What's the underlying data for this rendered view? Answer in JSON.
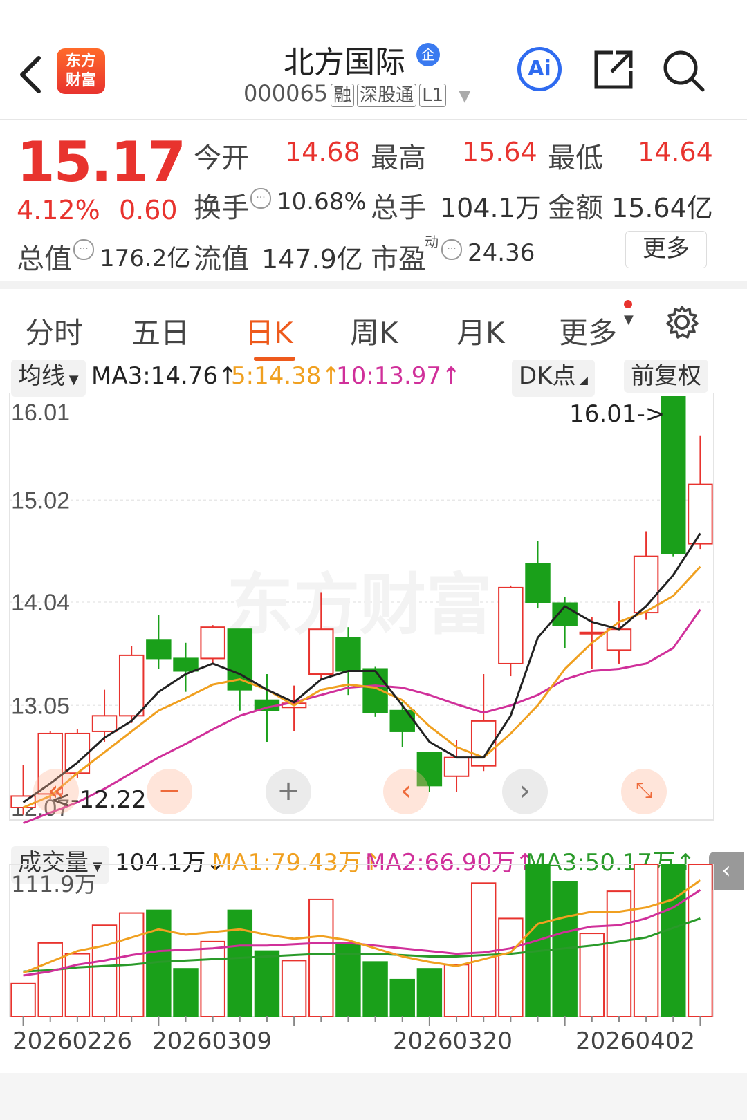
{
  "header": {
    "back_icon": "chevron-left-icon",
    "logo_text_1": "东方",
    "logo_text_2": "财富",
    "stock_name": "北方国际",
    "enterprise_badge": "企",
    "stock_code": "000065",
    "tags": [
      "融",
      "深股通",
      "L1"
    ],
    "ai_label": "Ai",
    "share_icon": "share-icon",
    "search_icon": "search-icon"
  },
  "quote": {
    "price": "15.17",
    "change_pct": "4.12%",
    "change_amt": "0.60",
    "open_label": "今开",
    "open": "14.68",
    "high_label": "最高",
    "high": "15.64",
    "low_label": "最低",
    "low": "14.64",
    "turnover_label": "换手",
    "turnover": "10.68%",
    "volume_label": "总手",
    "volume": "104.1万",
    "amount_label": "金额",
    "amount": "15.64亿",
    "mktcap_label": "总值",
    "mktcap": "176.2亿",
    "float_label": "流值",
    "float_cap": "147.9亿",
    "pe_label": "市盈",
    "pe_sup": "动",
    "pe": "24.36",
    "more_button": "更多"
  },
  "tabs": [
    "分时",
    "五日",
    "日K",
    "周K",
    "月K",
    "更多"
  ],
  "active_tab": "日K",
  "ma_row": {
    "selector": "均线",
    "ma3": "MA3:14.76",
    "ma5": "5:14.38",
    "ma10": "10:13.97",
    "dk_button": "DK点",
    "adjust_button": "前复权"
  },
  "colors": {
    "up": "#e8332e",
    "down": "#1aa01a",
    "ma3": "#222222",
    "ma5": "#f0a020",
    "ma10": "#d0309a",
    "vol_ma3": "#2a9a2a",
    "accent": "#ee5a1c"
  },
  "chart_labels": {
    "y_ticks": [
      "16.01",
      "15.02",
      "14.04",
      "13.05",
      "12.07"
    ],
    "max_label": "16.01->",
    "min_label": "<-12.22"
  },
  "volume_row": {
    "selector": "成交量",
    "vol": "104.1万",
    "ma1": "MA1:79.43万",
    "ma2": "MA2:66.90万",
    "ma3": "MA3:50.17万",
    "vol_max": "111.9万"
  },
  "x_dates": [
    "20260226",
    "20260309",
    "20260320",
    "20260402"
  ],
  "chart_data": {
    "type": "candlestick",
    "ylim": [
      12.07,
      16.01
    ],
    "candles": [
      {
        "o": 12.07,
        "c": 12.18,
        "h": 12.48,
        "l": 12.0
      },
      {
        "o": 12.2,
        "c": 12.78,
        "h": 12.8,
        "l": 12.15
      },
      {
        "o": 12.4,
        "c": 12.78,
        "h": 12.82,
        "l": 12.35
      },
      {
        "o": 12.8,
        "c": 12.95,
        "h": 13.2,
        "l": 12.7
      },
      {
        "o": 12.95,
        "c": 13.53,
        "h": 13.62,
        "l": 12.88
      },
      {
        "o": 13.68,
        "c": 13.5,
        "h": 13.92,
        "l": 13.4
      },
      {
        "o": 13.5,
        "c": 13.38,
        "h": 13.65,
        "l": 13.18
      },
      {
        "o": 13.5,
        "c": 13.8,
        "h": 13.82,
        "l": 13.44
      },
      {
        "o": 13.78,
        "c": 13.2,
        "h": 13.78,
        "l": 13.0
      },
      {
        "o": 13.1,
        "c": 13.0,
        "h": 13.35,
        "l": 12.7
      },
      {
        "o": 13.03,
        "c": 13.07,
        "h": 13.24,
        "l": 12.8
      },
      {
        "o": 13.35,
        "c": 13.78,
        "h": 14.13,
        "l": 13.3
      },
      {
        "o": 13.7,
        "c": 13.38,
        "h": 13.8,
        "l": 13.15
      },
      {
        "o": 13.4,
        "c": 12.98,
        "h": 13.42,
        "l": 12.94
      },
      {
        "o": 13.0,
        "c": 12.8,
        "h": 13.08,
        "l": 12.65
      },
      {
        "o": 12.6,
        "c": 12.28,
        "h": 12.6,
        "l": 12.22
      },
      {
        "o": 12.37,
        "c": 12.55,
        "h": 12.72,
        "l": 12.22
      },
      {
        "o": 12.47,
        "c": 12.9,
        "h": 13.35,
        "l": 12.42
      },
      {
        "o": 13.45,
        "c": 14.18,
        "h": 14.2,
        "l": 13.33
      },
      {
        "o": 14.41,
        "c": 14.04,
        "h": 14.63,
        "l": 13.98
      },
      {
        "o": 14.03,
        "c": 13.82,
        "h": 14.09,
        "l": 13.6
      },
      {
        "o": 13.75,
        "c": 13.75,
        "h": 13.9,
        "l": 13.4
      },
      {
        "o": 13.58,
        "c": 13.78,
        "h": 14.05,
        "l": 13.45
      },
      {
        "o": 13.94,
        "c": 14.48,
        "h": 14.72,
        "l": 13.87
      },
      {
        "o": 16.01,
        "c": 14.51,
        "h": 16.01,
        "l": 14.48
      },
      {
        "o": 14.6,
        "c": 15.17,
        "h": 15.64,
        "l": 14.55
      }
    ],
    "ma3": [
      12.12,
      12.3,
      12.5,
      12.74,
      12.9,
      13.18,
      13.35,
      13.45,
      13.35,
      13.2,
      13.08,
      13.3,
      13.38,
      13.38,
      13.05,
      12.7,
      12.55,
      12.55,
      12.95,
      13.7,
      14.0,
      13.85,
      13.78,
      14.0,
      14.3,
      14.7
    ],
    "ma5": [
      12.07,
      12.18,
      12.4,
      12.6,
      12.8,
      13.0,
      13.12,
      13.25,
      13.3,
      13.2,
      13.05,
      13.2,
      13.25,
      13.22,
      13.1,
      12.85,
      12.65,
      12.55,
      12.78,
      13.05,
      13.4,
      13.65,
      13.85,
      13.95,
      14.1,
      14.38
    ],
    "ma10": [
      11.92,
      12.02,
      12.12,
      12.25,
      12.4,
      12.55,
      12.68,
      12.82,
      12.95,
      13.03,
      13.08,
      13.15,
      13.22,
      13.24,
      13.22,
      13.15,
      13.06,
      12.98,
      13.05,
      13.15,
      13.3,
      13.38,
      13.4,
      13.45,
      13.6,
      13.97
    ],
    "volume": [
      24,
      54,
      46,
      67,
      76,
      78,
      35,
      55,
      78,
      48,
      41,
      86,
      53,
      40,
      27,
      35,
      38,
      98,
      72,
      134,
      99,
      61,
      92,
      117,
      180,
      162
    ],
    "vol_max": 111.9,
    "vol_ma1": [
      32,
      40,
      48,
      52,
      58,
      64,
      60,
      62,
      64,
      60,
      57,
      59,
      56,
      50,
      44,
      40,
      37,
      42,
      47,
      68,
      73,
      77,
      77,
      80,
      86,
      100
    ],
    "vol_ma2": [
      30,
      33,
      38,
      41,
      45,
      48,
      49,
      50,
      52,
      52,
      53,
      54,
      54,
      52,
      50,
      48,
      46,
      47,
      50,
      56,
      62,
      66,
      67,
      72,
      80,
      93
    ],
    "vol_ma3": [
      33,
      34,
      36,
      37,
      38,
      40,
      41,
      42,
      43,
      44,
      45,
      46,
      46,
      46,
      45,
      44,
      44,
      45,
      46,
      48,
      50,
      52,
      55,
      58,
      65,
      72
    ]
  }
}
